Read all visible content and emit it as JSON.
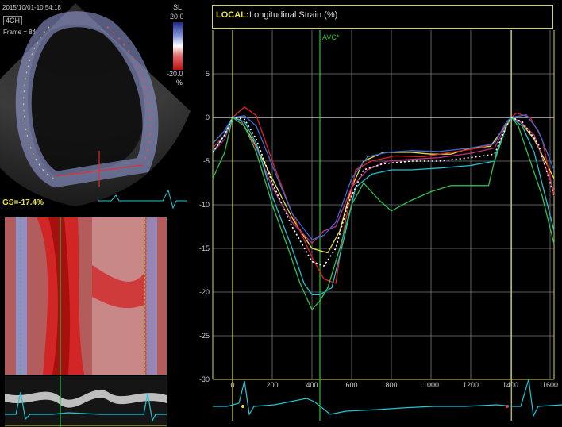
{
  "echo": {
    "timestamp": "2015/10/01-10:54:18",
    "view": "4CH",
    "frame": "Frame = 84",
    "gs": "GS=-17.4%",
    "scale": {
      "label": "SL",
      "top": "20.0",
      "bottom": "-20.0",
      "unit": "%"
    }
  },
  "header": {
    "label": "LOCAL:",
    "title": "Longitudinal Strain (%)"
  },
  "marker": {
    "label": "AVC*"
  },
  "colors": {
    "axis": "#d8d45a",
    "grid": "#7a7a7a",
    "avc": "#22cc22",
    "ecg": "#21c7d6"
  },
  "chart_data": {
    "type": "line",
    "xlabel": "",
    "ylabel": "",
    "xlim": [
      -100,
      1620
    ],
    "ylim": [
      -30,
      10
    ],
    "x_ticks": [
      0,
      200,
      400,
      600,
      800,
      1000,
      1200,
      1400,
      1600
    ],
    "y_ticks": [
      5,
      0,
      -5,
      -10,
      -15,
      -20,
      -25,
      -30
    ],
    "vertical_markers": [
      {
        "x": 0,
        "color": "#d8d45a"
      },
      {
        "x": 440,
        "label": "AVC*",
        "color": "#22cc22"
      },
      {
        "x": 1405,
        "color": "#d8d45a"
      }
    ],
    "series": [
      {
        "color": "#e8e040",
        "style": "solid",
        "points": [
          [
            -100,
            -3
          ],
          [
            -40,
            -1.5
          ],
          [
            0,
            0
          ],
          [
            40,
            -0.3
          ],
          [
            100,
            -2.5
          ],
          [
            200,
            -7
          ],
          [
            300,
            -11.5
          ],
          [
            400,
            -15
          ],
          [
            480,
            -15.5
          ],
          [
            540,
            -13
          ],
          [
            600,
            -8
          ],
          [
            660,
            -5
          ],
          [
            760,
            -4
          ],
          [
            900,
            -4
          ],
          [
            1000,
            -4.2
          ],
          [
            1100,
            -4.2
          ],
          [
            1200,
            -3.5
          ],
          [
            1300,
            -3.3
          ],
          [
            1380,
            -0.8
          ],
          [
            1405,
            0
          ],
          [
            1450,
            -0.5
          ],
          [
            1520,
            -2.5
          ],
          [
            1620,
            -7
          ]
        ]
      },
      {
        "color": "#e02020",
        "style": "solid",
        "points": [
          [
            -100,
            -3.5
          ],
          [
            -40,
            -2
          ],
          [
            0,
            0
          ],
          [
            60,
            1.2
          ],
          [
            120,
            0.2
          ],
          [
            200,
            -5
          ],
          [
            300,
            -11
          ],
          [
            400,
            -16
          ],
          [
            460,
            -18.5
          ],
          [
            520,
            -19
          ],
          [
            560,
            -13
          ],
          [
            620,
            -6
          ],
          [
            700,
            -5
          ],
          [
            820,
            -4.4
          ],
          [
            960,
            -4.5
          ],
          [
            1100,
            -4
          ],
          [
            1240,
            -3.5
          ],
          [
            1320,
            -3
          ],
          [
            1380,
            -0.5
          ],
          [
            1405,
            0
          ],
          [
            1430,
            0.5
          ],
          [
            1500,
            0
          ],
          [
            1560,
            -2.5
          ],
          [
            1620,
            -9
          ]
        ]
      },
      {
        "color": "#c03080",
        "style": "solid",
        "points": [
          [
            -100,
            -4
          ],
          [
            -40,
            -2.5
          ],
          [
            0,
            0
          ],
          [
            40,
            -0.3
          ],
          [
            120,
            -3.5
          ],
          [
            200,
            -8
          ],
          [
            300,
            -12
          ],
          [
            400,
            -14.4
          ],
          [
            460,
            -13
          ],
          [
            520,
            -12.5
          ],
          [
            600,
            -8
          ],
          [
            680,
            -6
          ],
          [
            780,
            -5
          ],
          [
            900,
            -4.8
          ],
          [
            1040,
            -4.6
          ],
          [
            1200,
            -4.1
          ],
          [
            1320,
            -3.5
          ],
          [
            1380,
            -0.8
          ],
          [
            1405,
            0
          ],
          [
            1450,
            -0.5
          ],
          [
            1520,
            -2
          ],
          [
            1620,
            -8.5
          ]
        ]
      },
      {
        "color": "#3a6ad8",
        "style": "solid",
        "points": [
          [
            -100,
            -3
          ],
          [
            -40,
            -1.5
          ],
          [
            0,
            0
          ],
          [
            60,
            0.2
          ],
          [
            120,
            -1
          ],
          [
            200,
            -5.5
          ],
          [
            300,
            -11
          ],
          [
            400,
            -14
          ],
          [
            460,
            -13.5
          ],
          [
            520,
            -12
          ],
          [
            600,
            -7
          ],
          [
            680,
            -4.5
          ],
          [
            780,
            -4
          ],
          [
            900,
            -3.8
          ],
          [
            1040,
            -3.9
          ],
          [
            1200,
            -3.5
          ],
          [
            1320,
            -3
          ],
          [
            1380,
            -0.5
          ],
          [
            1405,
            0
          ],
          [
            1480,
            0.3
          ],
          [
            1540,
            -1.5
          ],
          [
            1620,
            -6
          ]
        ]
      },
      {
        "color": "#20c0d0",
        "style": "solid",
        "points": [
          [
            -100,
            -4
          ],
          [
            -40,
            -2
          ],
          [
            0,
            0
          ],
          [
            60,
            -0.5
          ],
          [
            120,
            -3
          ],
          [
            200,
            -9
          ],
          [
            300,
            -15
          ],
          [
            360,
            -19
          ],
          [
            400,
            -20.3
          ],
          [
            440,
            -20.3
          ],
          [
            500,
            -19.5
          ],
          [
            560,
            -14
          ],
          [
            620,
            -8
          ],
          [
            700,
            -6.5
          ],
          [
            800,
            -6
          ],
          [
            900,
            -6
          ],
          [
            1040,
            -5.8
          ],
          [
            1200,
            -5.5
          ],
          [
            1320,
            -5
          ],
          [
            1380,
            -1
          ],
          [
            1405,
            0
          ],
          [
            1460,
            -1
          ],
          [
            1520,
            -4
          ],
          [
            1620,
            -13
          ]
        ]
      },
      {
        "color": "#30c050",
        "style": "solid",
        "points": [
          [
            -100,
            -7
          ],
          [
            -40,
            -4
          ],
          [
            0,
            0
          ],
          [
            60,
            -1
          ],
          [
            120,
            -4
          ],
          [
            200,
            -10
          ],
          [
            280,
            -15
          ],
          [
            340,
            -19
          ],
          [
            400,
            -22
          ],
          [
            440,
            -21
          ],
          [
            480,
            -19.5
          ],
          [
            540,
            -15
          ],
          [
            600,
            -10
          ],
          [
            660,
            -7.5
          ],
          [
            740,
            -9.5
          ],
          [
            800,
            -10.7
          ],
          [
            900,
            -9.5
          ],
          [
            1000,
            -8.5
          ],
          [
            1100,
            -7.8
          ],
          [
            1200,
            -7.8
          ],
          [
            1290,
            -7.8
          ],
          [
            1330,
            -4
          ],
          [
            1380,
            -1
          ],
          [
            1405,
            0
          ],
          [
            1440,
            -1
          ],
          [
            1500,
            -5
          ],
          [
            1560,
            -9
          ],
          [
            1620,
            -14.5
          ]
        ]
      },
      {
        "color": "#ffffff",
        "style": "dotted",
        "points": [
          [
            -100,
            -4
          ],
          [
            -40,
            -2
          ],
          [
            0,
            0
          ],
          [
            60,
            -0.2
          ],
          [
            120,
            -2.5
          ],
          [
            200,
            -7.5
          ],
          [
            300,
            -12.5
          ],
          [
            400,
            -16.5
          ],
          [
            460,
            -17
          ],
          [
            520,
            -15
          ],
          [
            580,
            -10
          ],
          [
            660,
            -6
          ],
          [
            760,
            -5.3
          ],
          [
            900,
            -5
          ],
          [
            1040,
            -5
          ],
          [
            1200,
            -4.6
          ],
          [
            1320,
            -4.2
          ],
          [
            1380,
            -1
          ],
          [
            1405,
            0
          ],
          [
            1460,
            -0.5
          ],
          [
            1540,
            -3
          ],
          [
            1620,
            -9
          ]
        ]
      }
    ]
  }
}
